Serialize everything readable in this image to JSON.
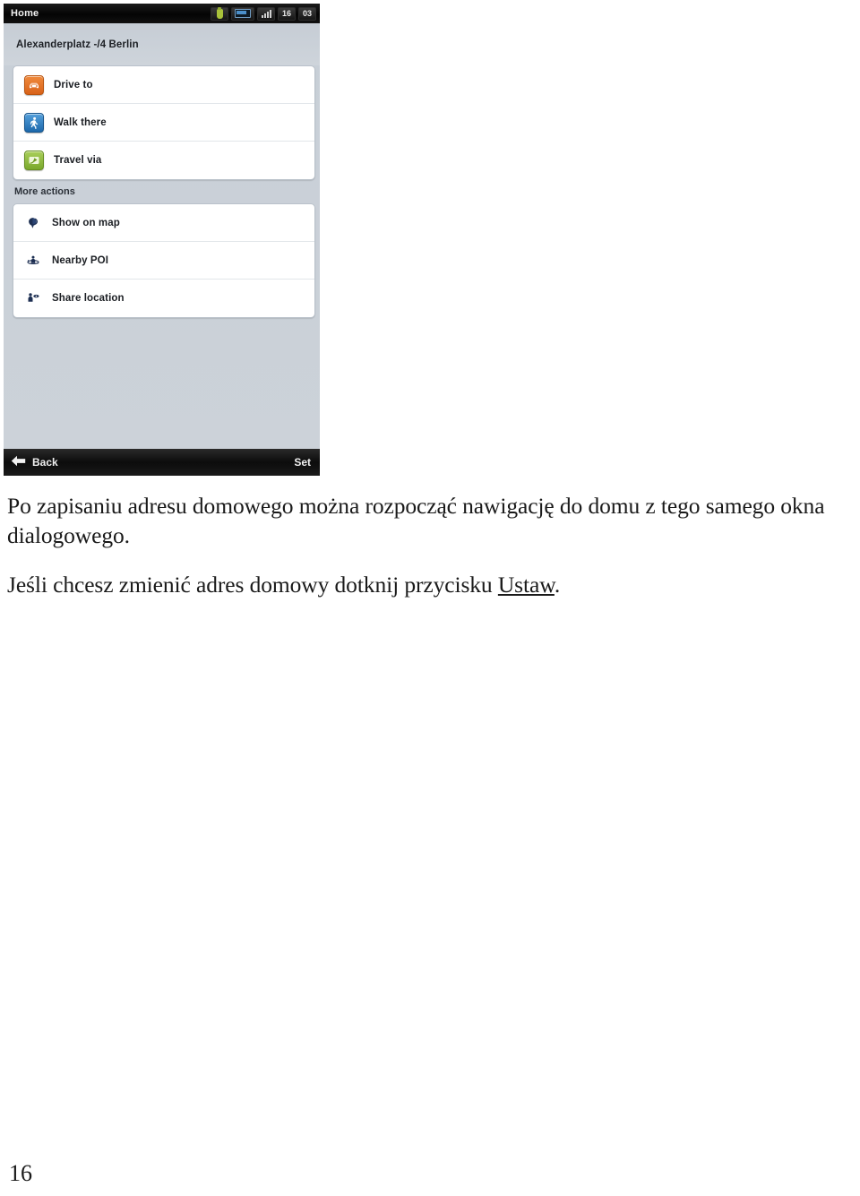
{
  "device": {
    "statusbar": {
      "title": "Home",
      "icons": [
        "usb-icon",
        "battery-icon",
        "signal-icon"
      ],
      "clock_hours": "16",
      "clock_minutes": "03"
    },
    "address": "Alexanderplatz -/4  Berlin",
    "primary_actions": [
      {
        "label": "Drive to",
        "icon": "car-icon",
        "color": "#d8621a"
      },
      {
        "label": "Walk there",
        "icon": "pedestrian-icon",
        "color": "#1d68ab"
      },
      {
        "label": "Travel via",
        "icon": "waypoint-icon",
        "color": "#7aa82c"
      }
    ],
    "more_actions_header": "More actions",
    "more_actions": [
      {
        "label": "Show on map",
        "icon": "map-pin-globe-icon"
      },
      {
        "label": "Nearby POI",
        "icon": "nearby-poi-icon"
      },
      {
        "label": "Share location",
        "icon": "share-location-icon"
      }
    ],
    "bottombar": {
      "back_label": "Back",
      "back_icon": "arrow-left-icon",
      "set_label": "Set"
    }
  },
  "document": {
    "paragraph_1": "Po zapisaniu adresu domowego można rozpocząć nawigację do domu z tego samego okna dialogowego.",
    "paragraph_2_before": "Jeśli chcesz zmienić adres domowy dotknij przycisku ",
    "paragraph_2_link": "Ustaw",
    "paragraph_2_after": ".",
    "page_number": "16"
  }
}
